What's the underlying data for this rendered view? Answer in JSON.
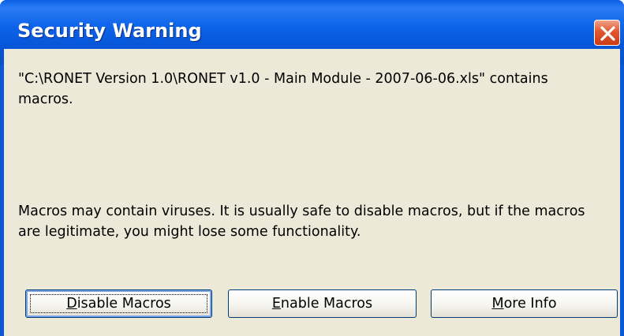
{
  "window": {
    "title": "Security Warning"
  },
  "message": {
    "line1": "\"C:\\RONET Version 1.0\\RONET v1.0 - Main Module - 2007-06-06.xls\" contains macros.",
    "line2": "Macros may contain viruses. It is usually safe to disable macros, but if the macros are legitimate, you might lose some functionality."
  },
  "buttons": {
    "disable": {
      "accel": "D",
      "rest": "isable Macros"
    },
    "enable": {
      "accel": "E",
      "rest": "nable Macros"
    },
    "more": {
      "accel": "M",
      "rest": "ore Info"
    }
  },
  "colors": {
    "titlebar": "#0a5fe6",
    "client_bg": "#ece9d8",
    "close_button": "#e2572f"
  },
  "icons": {
    "close": "close-icon"
  }
}
